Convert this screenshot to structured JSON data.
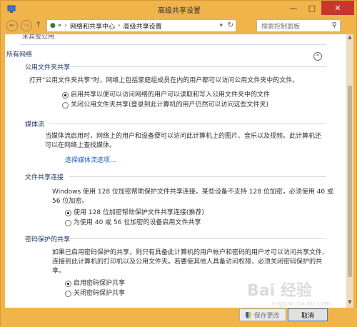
{
  "window": {
    "title": "高级共享设置",
    "controls": {
      "minimize": "—",
      "maximize": "□",
      "close": "✕"
    }
  },
  "address_bar": {
    "overflow": "«",
    "crumbs": [
      "网络和共享中心",
      "高级共享设置"
    ],
    "separator": "›",
    "search_placeholder": "搜索控制面板"
  },
  "partial_header": "来宾或公用",
  "sections": {
    "all_networks": {
      "label": "所有网络"
    },
    "public_folder": {
      "title": "公用文件夹共享",
      "description": "打开\"公用文件夹共享\"时，网络上包括家庭组成员在内的用户都可以访问公用文件夹中的文件。",
      "options": [
        {
          "label": "启用共享以便可以访问网络的用户可以读取和写入公用文件夹中的文件",
          "selected": true
        },
        {
          "label": "关闭公用文件夹共享(登录到此计算机的用户仍然可以访问这些文件夹)",
          "selected": false
        }
      ]
    },
    "media": {
      "title": "媒体流",
      "description_lines": [
        "当媒体流启用时，网络上的用户和设备便可以访问此计算机上的图片、音乐以及视频。此计算机还",
        "可以在网络上查找媒体。"
      ],
      "link": "选择媒体流选项..."
    },
    "file_sharing": {
      "title": "文件共享连接",
      "description_lines": [
        "Windows 使用 128 位加密帮助保护文件共享连接。某些设备不支持 128 位加密，必须使用 40 或",
        "56 位加密。"
      ],
      "options": [
        {
          "label": "使用 128 位加密帮助保护文件共享连接(推荐)",
          "selected": true
        },
        {
          "label": "为使用 40 或 56 位加密的设备启用文件共享",
          "selected": false
        }
      ]
    },
    "password": {
      "title": "密码保护的共享",
      "description_lines": [
        "如果已启用密码保护的共享，则只有具备此计算机的用户帐户和密码的用户才可以访问共享文件、",
        "连接到此计算机的打印机以及公用文件夹。若要使其他人具备访问权限，必须关闭密码保护的共",
        "享。"
      ],
      "options": [
        {
          "label": "启用密码保护共享",
          "selected": true
        },
        {
          "label": "关闭密码保护共享",
          "selected": false
        }
      ]
    }
  },
  "footer": {
    "save_label": "保存更改",
    "cancel_label": "取消"
  },
  "watermark": {
    "brand": "Bai 经验",
    "url": "jingyan.baidu.com"
  },
  "colors": {
    "frame": "#f0b44a",
    "close": "#c7372f",
    "link": "#1a5bb8",
    "heading": "#1f3a66"
  }
}
